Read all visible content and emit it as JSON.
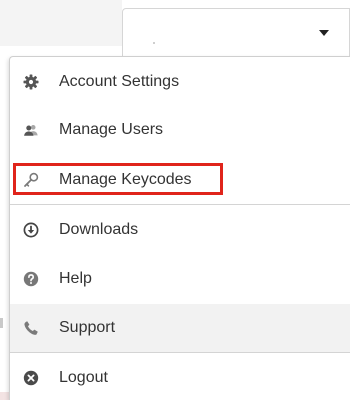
{
  "menu": {
    "items": [
      {
        "label": "Account Settings",
        "icon": "gear-icon"
      },
      {
        "label": "Manage Users",
        "icon": "users-icon"
      },
      {
        "label": "Manage Keycodes",
        "icon": "key-icon"
      },
      {
        "label": "Downloads",
        "icon": "download-icon"
      },
      {
        "label": "Help",
        "icon": "help-icon"
      },
      {
        "label": "Support",
        "icon": "phone-icon"
      },
      {
        "label": "Logout",
        "icon": "logout-icon"
      }
    ]
  },
  "colors": {
    "highlight": "#e0241b",
    "icon": "#555555",
    "hover_bg": "#f2f2f2"
  }
}
